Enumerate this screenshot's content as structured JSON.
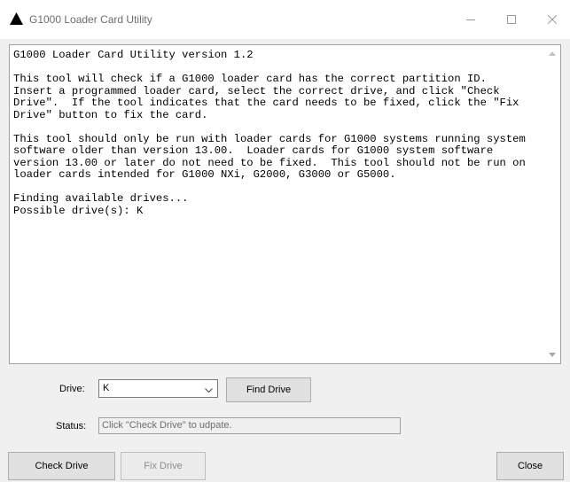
{
  "window": {
    "title": "G1000 Loader Card Utility",
    "app_icon": "black-triangle-icon",
    "controls": {
      "minimize_icon": "minimize-icon",
      "maximize_icon": "maximize-icon",
      "close_icon": "close-icon"
    }
  },
  "output": {
    "text": "G1000 Loader Card Utility version 1.2\n\nThis tool will check if a G1000 loader card has the correct partition ID.\nInsert a programmed loader card, select the correct drive, and click \"Check\nDrive\".  If the tool indicates that the card needs to be fixed, click the \"Fix\nDrive\" button to fix the card.\n\nThis tool should only be run with loader cards for G1000 systems running system\nsoftware older than version 13.00.  Loader cards for G1000 system software\nversion 13.00 or later do not need to be fixed.  This tool should not be run on\nloader cards intended for G1000 NXi, G2000, G3000 or G5000.\n\nFinding available drives...\nPossible drive(s): K"
  },
  "drive": {
    "label": "Drive:",
    "selected": "K",
    "dropdown_icon": "chevron-down-icon",
    "find_button": "Find Drive"
  },
  "status": {
    "label": "Status:",
    "value": "Click \"Check Drive\" to udpate."
  },
  "actions": {
    "check_drive": "Check Drive",
    "fix_drive": "Fix Drive",
    "close": "Close"
  },
  "colors": {
    "window_background": "#f0f0f0",
    "titlebar_background": "#ffffff",
    "button_face": "#e1e1e1",
    "disabled_text": "#8c8c8c"
  }
}
